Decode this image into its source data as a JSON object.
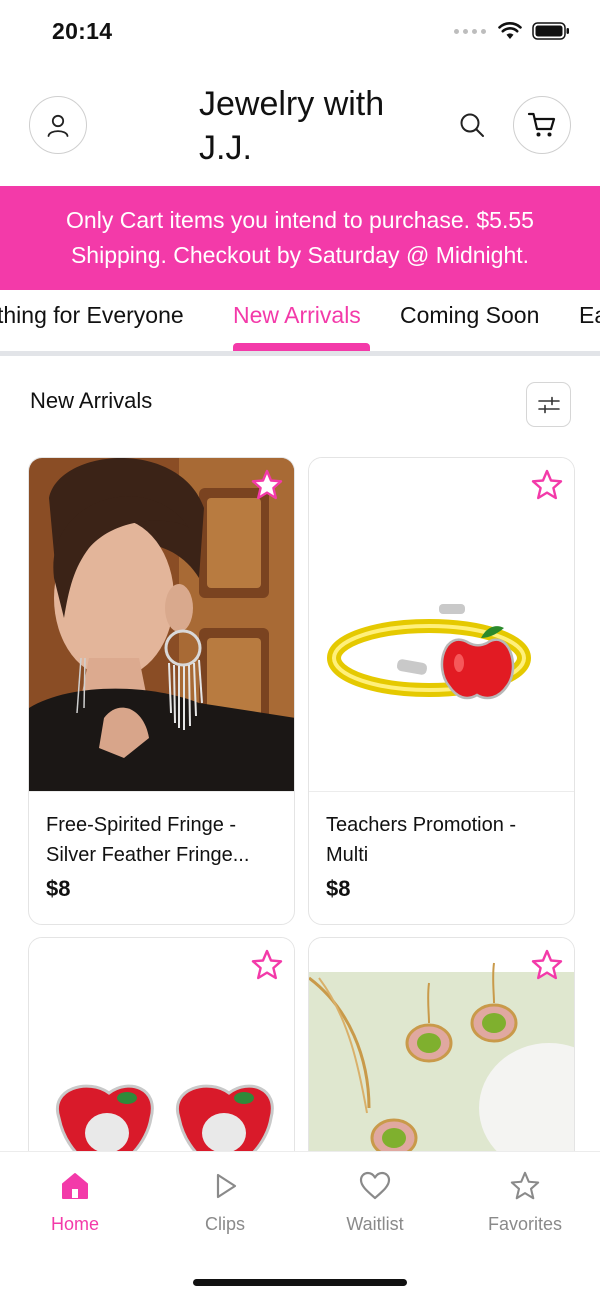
{
  "status": {
    "time": "20:14"
  },
  "header": {
    "title": "Jewelry with J.J."
  },
  "banner": {
    "text": "Only Cart items you intend to purchase. $5.55 Shipping. Checkout by Saturday @ Midnight."
  },
  "tabs": [
    {
      "label": "thing for Everyone",
      "active": false
    },
    {
      "label": "New Arrivals",
      "active": true
    },
    {
      "label": "Coming Soon",
      "active": false
    },
    {
      "label": "Ea",
      "active": false
    }
  ],
  "section": {
    "title": "New Arrivals"
  },
  "products": [
    {
      "name_line1": "Free-Spirited Fringe -",
      "name_line2": "Silver Feather Fringe...",
      "price": "$8",
      "favorited": false
    },
    {
      "name_line1": "Teachers Promotion -",
      "name_line2": "Multi",
      "price": "$8",
      "favorited": false
    },
    {
      "name_line1": "",
      "name_line2": "",
      "price": "",
      "favorited": false
    },
    {
      "name_line1": "",
      "name_line2": "",
      "price": "",
      "favorited": false
    }
  ],
  "bottom_nav": [
    {
      "label": "Home",
      "icon": "home-icon",
      "active": true
    },
    {
      "label": "Clips",
      "icon": "play-icon",
      "active": false
    },
    {
      "label": "Waitlist",
      "icon": "heart-icon",
      "active": false
    },
    {
      "label": "Favorites",
      "icon": "star-icon",
      "active": false
    }
  ],
  "colors": {
    "accent": "#f33aa9",
    "tab_divider": "#e2e4e8",
    "muted": "#8a8a8a"
  }
}
